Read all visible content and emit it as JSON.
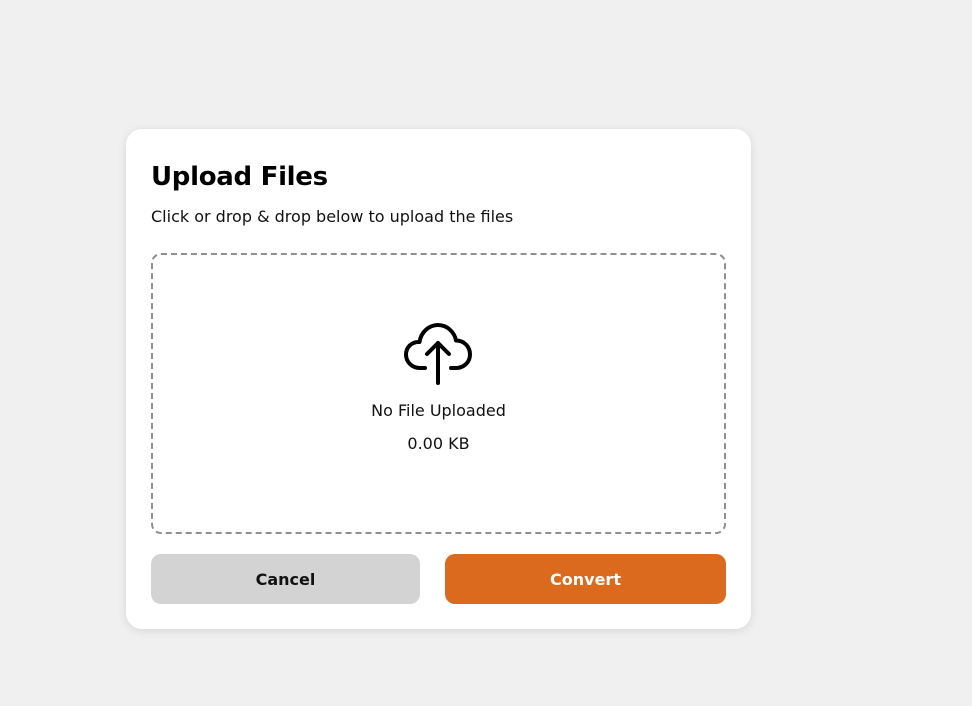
{
  "dialog": {
    "title": "Upload Files",
    "subtitle": "Click or drop & drop below to upload the files"
  },
  "dropzone": {
    "icon": "cloud-upload-icon",
    "file_name": "No File Uploaded",
    "file_size": "0.00 KB"
  },
  "actions": {
    "cancel_label": "Cancel",
    "convert_label": "Convert"
  },
  "colors": {
    "background": "#f0f0f0",
    "card": "#ffffff",
    "cancel_button": "#d3d3d3",
    "convert_button": "#db6a1f",
    "dropzone_border": "#8f8f8f"
  }
}
